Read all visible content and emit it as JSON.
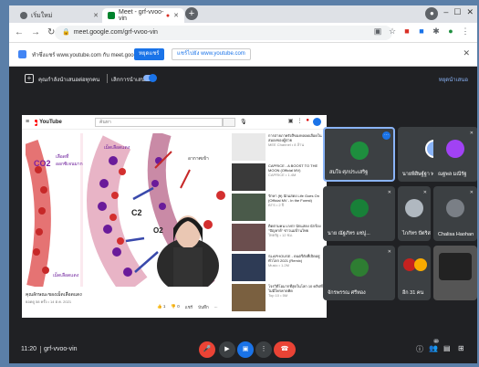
{
  "browser": {
    "tabs": [
      {
        "label": "เริ่มใหม่",
        "favicon_color": "#5f6368"
      },
      {
        "label": "Meet - grf-vvoo-vin",
        "favicon_color": "#00832d"
      }
    ],
    "new_tab_symbol": "+",
    "url": "meet.google.com/grf-vvoo-vin"
  },
  "infobar": {
    "message": "ทำซึ่งแชร์ www.youtube.com กับ meet.google.com",
    "stop_label": "หยุดแชร์",
    "switch_label": "แชร์ไปยัง www.youtube.com"
  },
  "meet_bar": {
    "presenting_text": "คุณกำลังนำเสนอต่อทุกคน",
    "stop_present_text": "เลิกการนำเสนอ",
    "right_link": "หยุดนำเสนอ"
  },
  "youtube": {
    "logo": "YouTube",
    "search_placeholder": "ค้นหา",
    "video_title": "คุณลักษณะของเม็ดเลือดแดง",
    "video_meta": "ยอดดู 58 ครั้ง • 14 ต.ค. 2021",
    "video_actions": [
      "👍 1",
      "👎 0",
      "แชร์",
      "บันทึก",
      "..."
    ],
    "diagram_labels": {
      "co2": "CO2",
      "leftnote1": "เลือดที่",
      "leftnote2": "ออกซิเจนมาก",
      "leftnote3": "เม็ดเลือดแดง",
      "topnote": "เม็ดเลือดแดง",
      "topright": "อากาศเข้า",
      "c2": "C2",
      "o2": "O2"
    },
    "sidebar": [
      {
        "title": "การถ่ายภาพรังสีของหลอดเลือดในสมองของผู้ป่วย",
        "sub": "MEE Channel • 8 ล้าน"
      },
      {
        "title": "CAPRICE - A BOOST TO THE MOON (Official MV)",
        "sub": "CAPRICE • 1.4M"
      },
      {
        "title": "รักษา (ft) นักแสดง Life Goes On (Official MV - In the Forest)",
        "sub": "BTS • 2 ปี"
      },
      {
        "title": "ติดตามคน LIVE! นักแสดง นักร้อง \"ปัญหาย์\" ข่าวแม่บ้านไทย",
        "sub": "ไทยรัฐ • 12 ชม."
      },
      {
        "title": "SLAPHOUSE - ดนตรีดังที่เปิดอยู่ทั่วโลก 2021 (Remix)",
        "sub": "Music • 1.2M"
      },
      {
        "title": "โจรวิดีโอมากที่สุดในโลก 10 คลิปที่ไม่มีใครคาดคิด",
        "sub": "Top 10 • 5M"
      }
    ]
  },
  "participants": [
    {
      "name": "สมใจ ศุภประเสริฐ",
      "avatar_color": "#1e8e3e",
      "type": "avatar",
      "active": true
    },
    {
      "name": "นายพิสิษฐ์ฐา พงษ์ก...",
      "avatar_color": "#8ab4f8",
      "type": "photo",
      "active": false
    },
    {
      "name": "ณฐพล มณีรัฐ",
      "avatar_color": "#a142f4",
      "type": "avatar",
      "active": false
    },
    {
      "name": "นาย ณัฐภัทร แซ่ปู...",
      "avatar_color": "#188038",
      "type": "photo",
      "active": false
    },
    {
      "name": "ไกกัทร ปัตริสต์",
      "avatar_color": "#b0b8c0",
      "type": "photo",
      "active": false
    },
    {
      "name": "Chalisa Haohan",
      "avatar_color": "#7a7f86",
      "type": "photo",
      "active": false
    },
    {
      "name": "จักรพรรณ ศรีทอง",
      "avatar_color": "#2e7d32",
      "type": "photo",
      "active": false
    },
    {
      "name": "อีก 31 คน",
      "avatar_color": "#c5221f",
      "type": "group",
      "active": false
    },
    {
      "name": "",
      "avatar_color": "#555",
      "type": "camera",
      "active": false
    }
  ],
  "bottom": {
    "time": "11:20",
    "meeting_code": "grf-vvoo-vin",
    "people_badge": "40"
  },
  "colors": {
    "end_call": "#ea4335",
    "present": "#1a73e8",
    "mute": "#ea4335"
  }
}
